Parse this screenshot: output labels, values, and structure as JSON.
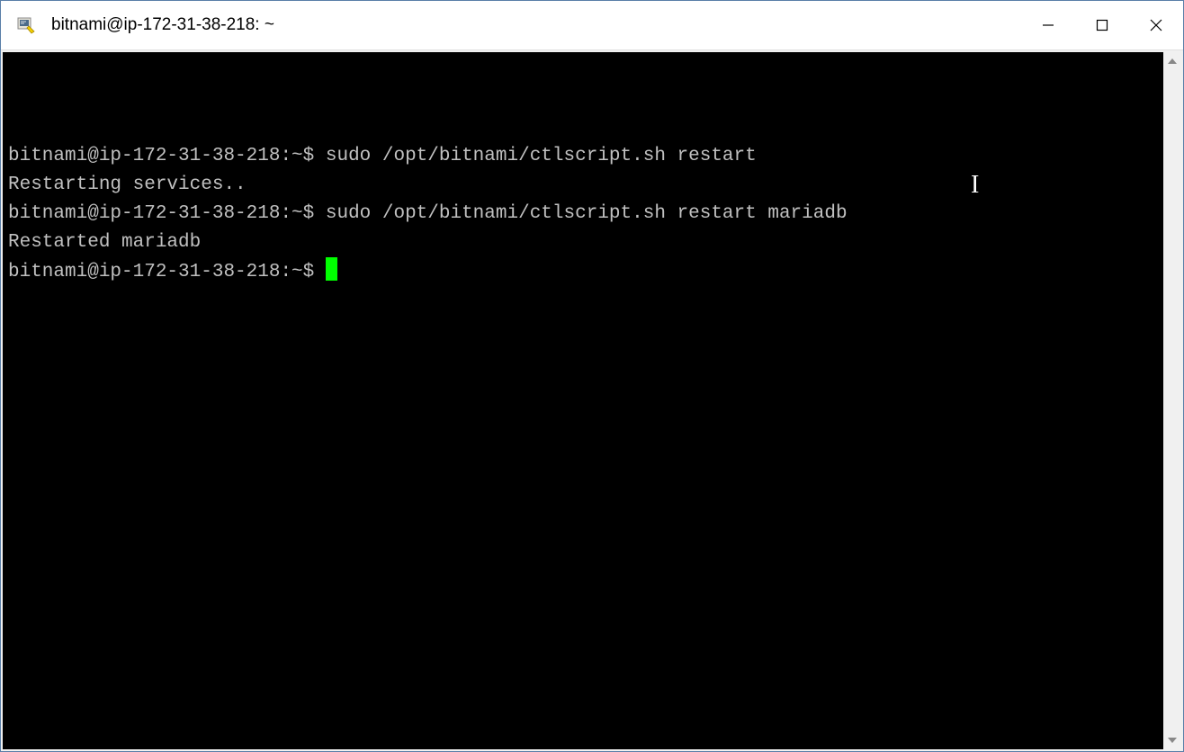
{
  "window": {
    "title": "bitnami@ip-172-31-38-218: ~"
  },
  "terminal": {
    "lines": [
      {
        "prompt": "bitnami@ip-172-31-38-218:~$ ",
        "command": "sudo /opt/bitnami/ctlscript.sh restart"
      },
      {
        "output": "Restarting services.."
      },
      {
        "prompt": "bitnami@ip-172-31-38-218:~$ ",
        "command": "sudo /opt/bitnami/ctlscript.sh restart mariadb"
      },
      {
        "output": "Restarted mariadb"
      },
      {
        "prompt": "bitnami@ip-172-31-38-218:~$ ",
        "cursor": true
      }
    ]
  }
}
